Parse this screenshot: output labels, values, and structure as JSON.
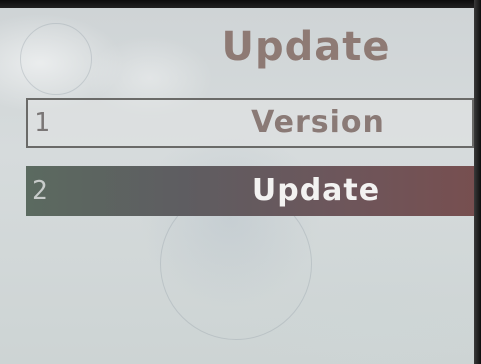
{
  "screen": {
    "title": "Update"
  },
  "menu": {
    "items": [
      {
        "number": "1",
        "label": "Version",
        "selected": false
      },
      {
        "number": "2",
        "label": "Update",
        "selected": true
      }
    ]
  },
  "colors": {
    "title_text": "#8e7a74",
    "screen_background": "#d2d8d8",
    "selected_row": "#6a5a5c",
    "selected_text": "#f3f2f1"
  }
}
